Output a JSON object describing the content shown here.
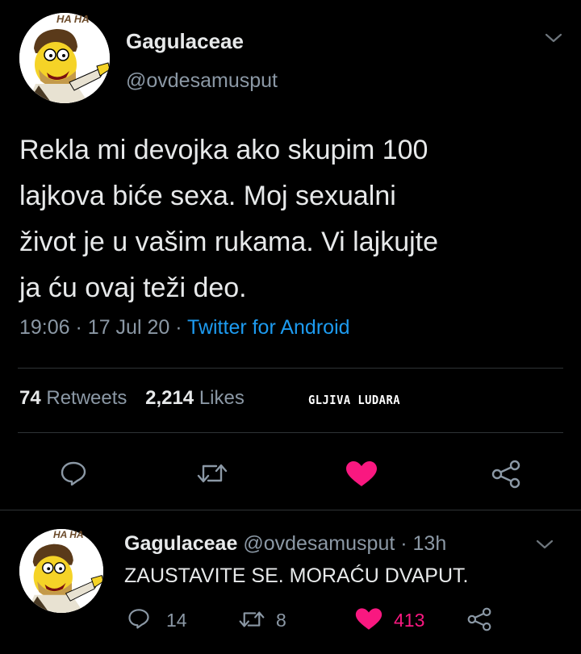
{
  "tweet": {
    "author_name": "Gagulaceae",
    "author_handle": "@ovdesamusput",
    "avatar_caption": "HA HA",
    "text_lines": [
      "Rekla mi devojka ako skupim 100",
      "lajkova biće sexa. Moj sexualni",
      "život je u vašim rukama. Vi lajkujte",
      "ja ću ovaj teži deo."
    ],
    "time": "19:06",
    "date": "17 Jul 20",
    "separator": "·",
    "source": "Twitter for Android",
    "retweets_count": "74",
    "retweets_label": "Retweets",
    "likes_count": "2,214",
    "likes_label": "Likes",
    "watermark": "GLJIVA LUDARA"
  },
  "reply": {
    "author_name": "Gagulaceae",
    "author_handle": "@ovdesamusput",
    "separator": "·",
    "age": "13h",
    "avatar_caption": "HA HA",
    "text": "ZAUSTAVITE SE. MORAĆU DVAPUT.",
    "reply_count": "14",
    "retweet_count": "8",
    "like_count": "413"
  },
  "icons": {
    "reply": "reply-icon",
    "retweet": "retweet-icon",
    "like": "heart-icon",
    "share": "share-icon",
    "more": "chevron-down-icon"
  },
  "colors": {
    "background": "#000000",
    "text": "#e7e9ea",
    "muted": "#8b98a5",
    "link": "#1d9bf0",
    "like": "#f91880",
    "divider": "#2f3336"
  }
}
